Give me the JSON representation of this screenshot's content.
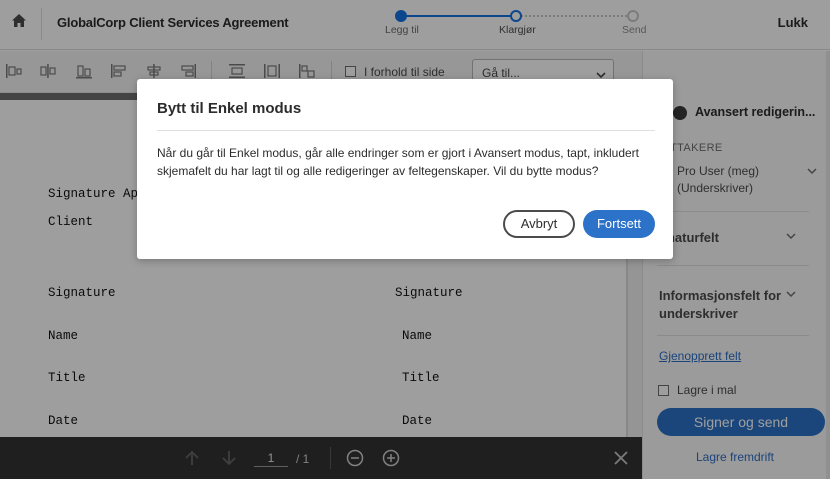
{
  "header": {
    "title": "GlobalCorp Client Services Agreement",
    "steps": [
      {
        "label": "Legg til"
      },
      {
        "label": "Klargjør"
      },
      {
        "label": "Send"
      }
    ],
    "close_label": "Lukk"
  },
  "toolbar": {
    "checkbox_label": "I forhold til side",
    "goto_value": "Gå til..."
  },
  "document": {
    "lines": {
      "signature_approval": "Signature Ap",
      "client": "Client",
      "sig_left": "Signature",
      "sig_right": "Signature",
      "name_left": "Name",
      "name_right": "Name",
      "title_left": "Title",
      "title_right": "Title",
      "date_left": "Date",
      "date_right": "Date"
    }
  },
  "bottom_bar": {
    "page_current": "1",
    "page_total": "/ 1"
  },
  "right_panel": {
    "toggle_label": "Avansert redigerin...",
    "recipients_heading": "OTTAKERE",
    "recipient_line1": "Pro User (meg)",
    "recipient_line2": "(Underskriver)",
    "section_signature": "gnaturfelt",
    "section_info_line1": "Informasjonsfelt for",
    "section_info_line2": "underskriver",
    "restore_link": "Gjenopprett felt",
    "save_template_label": "Lagre i mal",
    "primary_button": "Signer og send",
    "save_progress": "Lagre fremdrift"
  },
  "modal": {
    "title": "Bytt til Enkel modus",
    "body": "Når du går til Enkel modus, går alle endringer som er gjort i Avansert modus, tapt, inkludert skjemafelt du har lagt til og alle redigeringer av feltegenskaper. Vil du bytte modus?",
    "cancel_label": "Avbryt",
    "continue_label": "Fortsett"
  },
  "colors": {
    "accent": "#1473e6",
    "primary_button": "#2d72c9",
    "bottom_bar": "#323232"
  }
}
